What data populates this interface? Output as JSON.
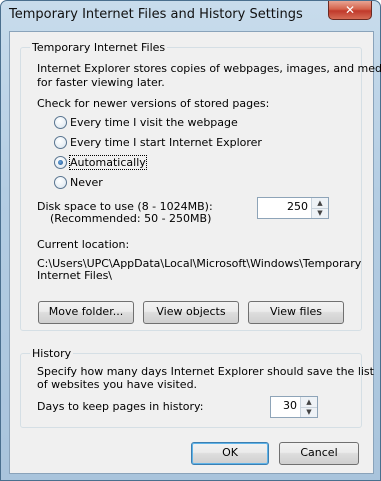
{
  "window": {
    "title": "Temporary Internet Files and History Settings",
    "close_glyph": "✕"
  },
  "temp_files": {
    "group_label": "Temporary Internet Files",
    "description_line1": "Internet Explorer stores copies of webpages, images, and media",
    "description_line2": "for faster viewing later.",
    "check_label": "Check for newer versions of stored pages:",
    "options": [
      {
        "label": "Every time I visit the webpage",
        "checked": false
      },
      {
        "label": "Every time I start Internet Explorer",
        "checked": false
      },
      {
        "label": "Automatically",
        "checked": true
      },
      {
        "label": "Never",
        "checked": false
      }
    ],
    "disk_label_line1": "Disk space to use (8 - 1024MB):",
    "disk_label_line2": "(Recommended: 50 - 250MB)",
    "disk_value": "250",
    "location_label": "Current location:",
    "location_line1": "C:\\Users\\UPC\\AppData\\Local\\Microsoft\\Windows\\Temporary",
    "location_line2": "Internet Files\\",
    "move_folder_label": "Move folder...",
    "view_objects_label": "View objects",
    "view_files_label": "View files"
  },
  "history": {
    "group_label": "History",
    "description_line1": "Specify how many days Internet Explorer should save the list",
    "description_line2": "of websites you have visited.",
    "days_label": "Days to keep pages in history:",
    "days_value": "30"
  },
  "footer": {
    "ok_label": "OK",
    "cancel_label": "Cancel"
  },
  "icons": {
    "spin_up": "▲",
    "spin_down": "▼"
  }
}
